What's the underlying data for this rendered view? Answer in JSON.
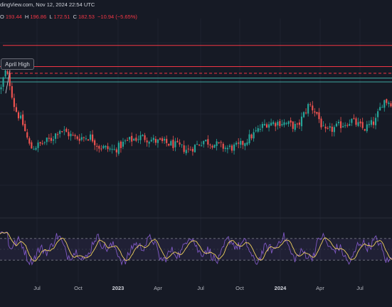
{
  "header": {
    "source": "dingView.com, Nov 12, 2024 22:54 UTC"
  },
  "ohlc": {
    "o_label": "O",
    "o_value": "193.44",
    "h_label": "H",
    "h_value": "196.86",
    "l_label": "L",
    "l_value": "172.51",
    "c_label": "C",
    "c_value": "182.53",
    "change": "−10.94 (−5.65%)"
  },
  "annotation": {
    "label": "April High"
  },
  "colors": {
    "background": "#161a25",
    "up": "#26a69a",
    "down": "#ef5350",
    "resistance": "#f23645",
    "support": "#3fa7a0",
    "rsi": "#7e57c2",
    "rsi_ma": "#f0d060",
    "rsi_band": "#7e57c2"
  },
  "chart_data": {
    "type": "candlestick",
    "x_tick_labels": [
      "Jul",
      "Oct",
      "2023",
      "Apr",
      "Jul",
      "Oct",
      "2024",
      "Apr",
      "Jul"
    ],
    "bold_tick_labels": [
      "2023",
      "2024"
    ],
    "price_waypoints": [
      {
        "t": 0.0,
        "v": 130
      },
      {
        "t": 0.01,
        "v": 148
      },
      {
        "t": 0.02,
        "v": 140
      },
      {
        "t": 0.035,
        "v": 110
      },
      {
        "t": 0.055,
        "v": 94
      },
      {
        "t": 0.075,
        "v": 68
      },
      {
        "t": 0.1,
        "v": 72
      },
      {
        "t": 0.13,
        "v": 78
      },
      {
        "t": 0.15,
        "v": 88
      },
      {
        "t": 0.19,
        "v": 79
      },
      {
        "t": 0.23,
        "v": 80
      },
      {
        "t": 0.25,
        "v": 70
      },
      {
        "t": 0.29,
        "v": 66
      },
      {
        "t": 0.32,
        "v": 75
      },
      {
        "t": 0.36,
        "v": 80
      },
      {
        "t": 0.4,
        "v": 75
      },
      {
        "t": 0.44,
        "v": 72
      },
      {
        "t": 0.48,
        "v": 66
      },
      {
        "t": 0.52,
        "v": 76
      },
      {
        "t": 0.55,
        "v": 72
      },
      {
        "t": 0.58,
        "v": 68
      },
      {
        "t": 0.61,
        "v": 70
      },
      {
        "t": 0.64,
        "v": 80
      },
      {
        "t": 0.68,
        "v": 94
      },
      {
        "t": 0.72,
        "v": 95
      },
      {
        "t": 0.76,
        "v": 90
      },
      {
        "t": 0.79,
        "v": 114
      },
      {
        "t": 0.81,
        "v": 104
      },
      {
        "t": 0.83,
        "v": 84
      },
      {
        "t": 0.87,
        "v": 92
      },
      {
        "t": 0.9,
        "v": 97
      },
      {
        "t": 0.93,
        "v": 88
      },
      {
        "t": 0.96,
        "v": 96
      },
      {
        "t": 0.98,
        "v": 118
      },
      {
        "t": 1.0,
        "v": 116
      }
    ],
    "price_range": [
      0,
      200
    ],
    "horizontal_levels": [
      {
        "value": 175,
        "kind": "resistance"
      },
      {
        "value": 153,
        "kind": "resistance"
      },
      {
        "value": 146,
        "kind": "resistance_dashed"
      },
      {
        "value": 141,
        "kind": "support"
      },
      {
        "value": 137,
        "kind": "support"
      }
    ],
    "rsi": {
      "range": [
        0,
        100
      ],
      "upper_band": 70,
      "lower_band": 30
    }
  }
}
